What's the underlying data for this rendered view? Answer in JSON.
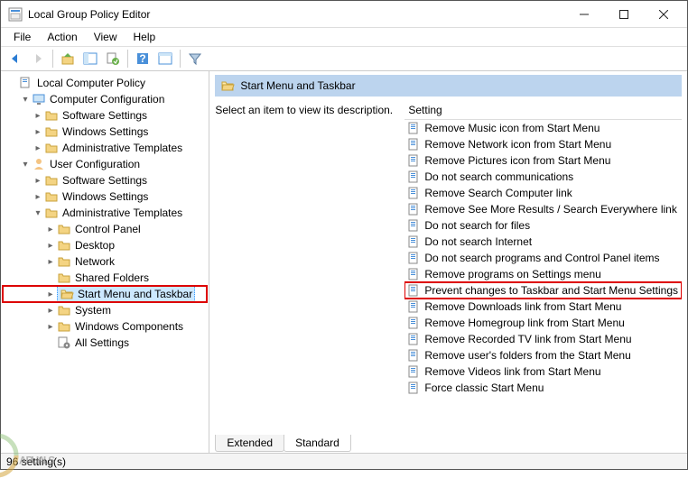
{
  "window": {
    "title": "Local Group Policy Editor"
  },
  "menubar": {
    "items": [
      "File",
      "Action",
      "View",
      "Help"
    ]
  },
  "tree": {
    "root": "Local Computer Policy",
    "computer_config": "Computer Configuration",
    "cc_children": [
      "Software Settings",
      "Windows Settings",
      "Administrative Templates"
    ],
    "user_config": "User Configuration",
    "uc_children": [
      "Software Settings",
      "Windows Settings"
    ],
    "admin_templates": "Administrative Templates",
    "at_children": [
      "Control Panel",
      "Desktop",
      "Network",
      "Shared Folders",
      "Start Menu and Taskbar",
      "System",
      "Windows Components",
      "All Settings"
    ]
  },
  "content": {
    "header": "Start Menu and Taskbar",
    "description_prompt": "Select an item to view its description.",
    "column_header": "Setting",
    "items": [
      "Remove Music icon from Start Menu",
      "Remove Network icon from Start Menu",
      "Remove Pictures icon from Start Menu",
      "Do not search communications",
      "Remove Search Computer link",
      "Remove See More Results / Search Everywhere link",
      "Do not search for files",
      "Do not search Internet",
      "Do not search programs and Control Panel items",
      "Remove programs on Settings menu",
      "Prevent changes to Taskbar and Start Menu Settings",
      "Remove Downloads link from Start Menu",
      "Remove Homegroup link from Start Menu",
      "Remove Recorded TV link from Start Menu",
      "Remove user's folders from the Start Menu",
      "Remove Videos link from Start Menu",
      "Force classic Start Menu"
    ],
    "highlighted_index": 10
  },
  "tabs": {
    "items": [
      "Extended",
      "Standard"
    ],
    "active": 0
  },
  "statusbar": {
    "text": "96 setting(s)"
  },
  "watermark": "A   PUALS"
}
